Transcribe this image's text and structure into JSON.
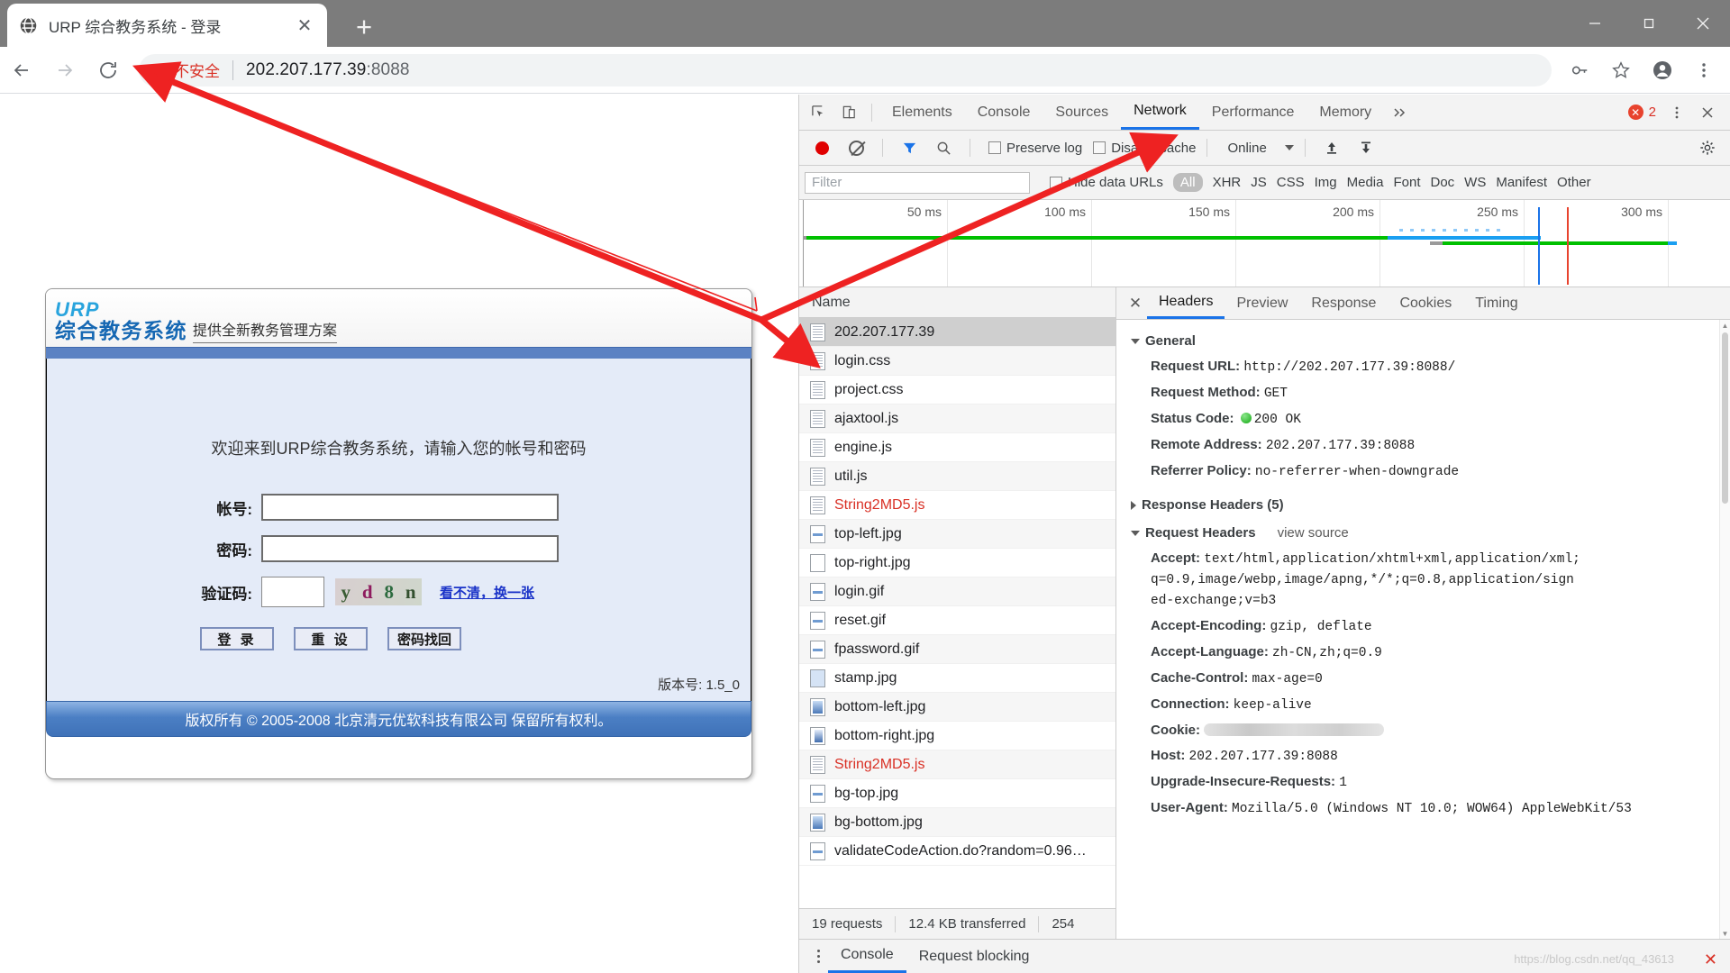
{
  "browser": {
    "tab": {
      "title": "URP 综合教务系统 - 登录",
      "favicon": "globe-icon",
      "close": "✕"
    },
    "newtab_label": "+",
    "window_controls": {
      "minimize": "—",
      "maximize": "❐",
      "close": "✕"
    },
    "nav": {
      "back": "←",
      "forward": "→",
      "reload": "⟳"
    },
    "omnibox": {
      "security_label": "不安全",
      "url_main": "202.207.177.39",
      "url_port": ":8088"
    },
    "toolbar_icons": [
      "key-icon",
      "star-icon",
      "profile-icon",
      "menu-icon"
    ]
  },
  "page": {
    "logo_line1": "URP",
    "logo_line2": "综合教务系统",
    "slogan": "提供全新教务管理方案",
    "welcome": "欢迎来到URP综合教务系统，请输入您的帐号和密码",
    "fields": [
      {
        "label": "帐号:",
        "value": "",
        "placeholder": ""
      },
      {
        "label": "密码:",
        "value": "",
        "placeholder": ""
      },
      {
        "label": "验证码:",
        "value": "",
        "placeholder": ""
      }
    ],
    "captcha": {
      "chars": [
        "y",
        "d",
        "8",
        "n"
      ],
      "refresh_link": "看不清，换一张"
    },
    "buttons": [
      {
        "label": "登 录"
      },
      {
        "label": "重 设"
      },
      {
        "label": "密码找回"
      }
    ],
    "version": "版本号: 1.5_0",
    "footer": "版权所有 © 2005-2008 北京清元优软科技有限公司 保留所有权利。"
  },
  "devtools": {
    "tabs": [
      {
        "label": "Elements",
        "active": false
      },
      {
        "label": "Console",
        "active": false
      },
      {
        "label": "Sources",
        "active": false
      },
      {
        "label": "Network",
        "active": true
      },
      {
        "label": "Performance",
        "active": false
      },
      {
        "label": "Memory",
        "active": false
      }
    ],
    "more_tabs_icon": "chevron-double-right-icon",
    "error_count": "2",
    "error_symbol": "✕",
    "close_icon": "✕",
    "settings_icon": "gear-icon",
    "dock_icons": [
      "inspect-icon",
      "device-toolbar-icon"
    ],
    "network_toolbar": {
      "record_tooltip": "record-icon",
      "clear_tooltip": "clear-icon",
      "filter_icon": "funnel-icon",
      "search_icon": "search-icon",
      "preserve_log": {
        "label": "Preserve log",
        "checked": false
      },
      "disable_cache": {
        "label": "Disable cache",
        "checked": false
      },
      "throttle": "Online",
      "import_icon": "upload-arrow-icon",
      "export_icon": "download-arrow-icon"
    },
    "filter_bar": {
      "placeholder": "Filter",
      "value": "",
      "hide_data_urls": {
        "label": "Hide data URLs",
        "checked": false
      },
      "types": [
        "All",
        "XHR",
        "JS",
        "CSS",
        "Img",
        "Media",
        "Font",
        "Doc",
        "WS",
        "Manifest",
        "Other"
      ],
      "active_type": "All"
    },
    "overview": {
      "ticks": [
        "50 ms",
        "100 ms",
        "150 ms",
        "200 ms",
        "250 ms",
        "300 ms"
      ]
    },
    "list_header": "Name",
    "requests": [
      {
        "name": "202.207.177.39",
        "icon": "doc",
        "error": false,
        "selected": true
      },
      {
        "name": "login.css",
        "icon": "doc",
        "error": false,
        "selected": false
      },
      {
        "name": "project.css",
        "icon": "doc",
        "error": false,
        "selected": false
      },
      {
        "name": "ajaxtool.js",
        "icon": "doc",
        "error": false,
        "selected": false
      },
      {
        "name": "engine.js",
        "icon": "doc",
        "error": false,
        "selected": false
      },
      {
        "name": "util.js",
        "icon": "doc",
        "error": false,
        "selected": false
      },
      {
        "name": "String2MD5.js",
        "icon": "doc",
        "error": true,
        "selected": false
      },
      {
        "name": "top-left.jpg",
        "icon": "img-a",
        "error": false,
        "selected": false
      },
      {
        "name": "top-right.jpg",
        "icon": "blank",
        "error": false,
        "selected": false
      },
      {
        "name": "login.gif",
        "icon": "img-a",
        "error": false,
        "selected": false
      },
      {
        "name": "reset.gif",
        "icon": "img-a",
        "error": false,
        "selected": false
      },
      {
        "name": "fpassword.gif",
        "icon": "img-a",
        "error": false,
        "selected": false
      },
      {
        "name": "stamp.jpg",
        "icon": "img-b",
        "error": false,
        "selected": false
      },
      {
        "name": "bottom-left.jpg",
        "icon": "img-c",
        "error": false,
        "selected": false
      },
      {
        "name": "bottom-right.jpg",
        "icon": "img-d",
        "error": false,
        "selected": false
      },
      {
        "name": "String2MD5.js",
        "icon": "doc",
        "error": true,
        "selected": false
      },
      {
        "name": "bg-top.jpg",
        "icon": "img-a",
        "error": false,
        "selected": false
      },
      {
        "name": "bg-bottom.jpg",
        "icon": "img-c",
        "error": false,
        "selected": false
      },
      {
        "name": "validateCodeAction.do?random=0.96…",
        "icon": "img-a",
        "error": false,
        "selected": false
      }
    ],
    "list_status": {
      "requests": "19 requests",
      "transferred": "12.4 KB transferred",
      "resources": "254"
    },
    "detail_tabs": [
      {
        "label": "Headers",
        "active": true
      },
      {
        "label": "Preview",
        "active": false
      },
      {
        "label": "Response",
        "active": false
      },
      {
        "label": "Cookies",
        "active": false
      },
      {
        "label": "Timing",
        "active": false
      }
    ],
    "sections": {
      "general": {
        "title": "General",
        "expanded": true,
        "rows": [
          {
            "key": "Request URL:",
            "value": "http://202.207.177.39:8088/"
          },
          {
            "key": "Request Method:",
            "value": "GET"
          },
          {
            "key": "Status Code:",
            "value": "200 OK",
            "status_dot": true
          },
          {
            "key": "Remote Address:",
            "value": "202.207.177.39:8088"
          },
          {
            "key": "Referrer Policy:",
            "value": "no-referrer-when-downgrade"
          }
        ]
      },
      "response_headers": {
        "title": "Response Headers (5)",
        "expanded": false
      },
      "request_headers": {
        "title": "Request Headers",
        "view_source": "view source",
        "expanded": true,
        "rows": [
          {
            "key": "Accept:",
            "value": "text/html,application/xhtml+xml,application/xml;q=0.9,image/webp,image/apng,*/*;q=0.8,application/signed-exchange;v=b3"
          },
          {
            "key": "Accept-Encoding:",
            "value": "gzip, deflate"
          },
          {
            "key": "Accept-Language:",
            "value": "zh-CN,zh;q=0.9"
          },
          {
            "key": "Cache-Control:",
            "value": "max-age=0"
          },
          {
            "key": "Connection:",
            "value": "keep-alive"
          },
          {
            "key": "Cookie:",
            "value": "",
            "redacted": true
          },
          {
            "key": "Host:",
            "value": "202.207.177.39:8088"
          },
          {
            "key": "Upgrade-Insecure-Requests:",
            "value": "1"
          },
          {
            "key": "User-Agent:",
            "value": "Mozilla/5.0 (Windows NT 10.0; WOW64) AppleWebKit/53"
          }
        ]
      }
    },
    "console_drawer": {
      "tabs": [
        {
          "label": "Console",
          "active": true
        },
        {
          "label": "Request blocking",
          "active": false
        }
      ],
      "menu_icon": "more-vertical-icon"
    }
  },
  "watermark": {
    "text": "https://blog.csdn.net/qq_43613",
    "close": "✕"
  }
}
